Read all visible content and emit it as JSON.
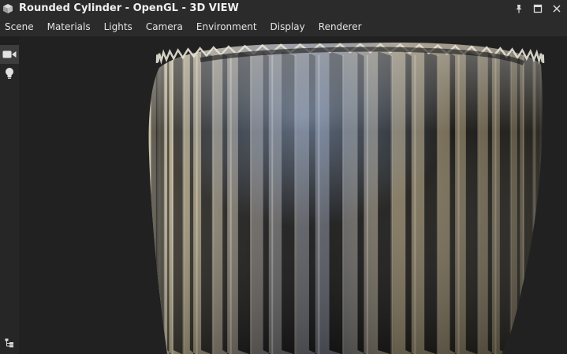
{
  "window": {
    "title": "Rounded Cylinder - OpenGL - 3D VIEW",
    "icons": {
      "logo": "cube-logo-icon",
      "pin": "pin-icon",
      "maximize": "maximize-icon",
      "close": "close-icon"
    }
  },
  "menu": {
    "items": [
      "Scene",
      "Materials",
      "Lights",
      "Camera",
      "Environment",
      "Display",
      "Renderer"
    ]
  },
  "sidebar": {
    "tools": [
      {
        "icon": "camera-icon",
        "active": true
      },
      {
        "icon": "light-bulb-icon",
        "active": false
      }
    ],
    "bottom_icon": "hierarchy-icon"
  },
  "viewport": {
    "subject": "Rounded Cylinder",
    "background_color": "#212121",
    "surface_color": "#b7aa8c"
  }
}
